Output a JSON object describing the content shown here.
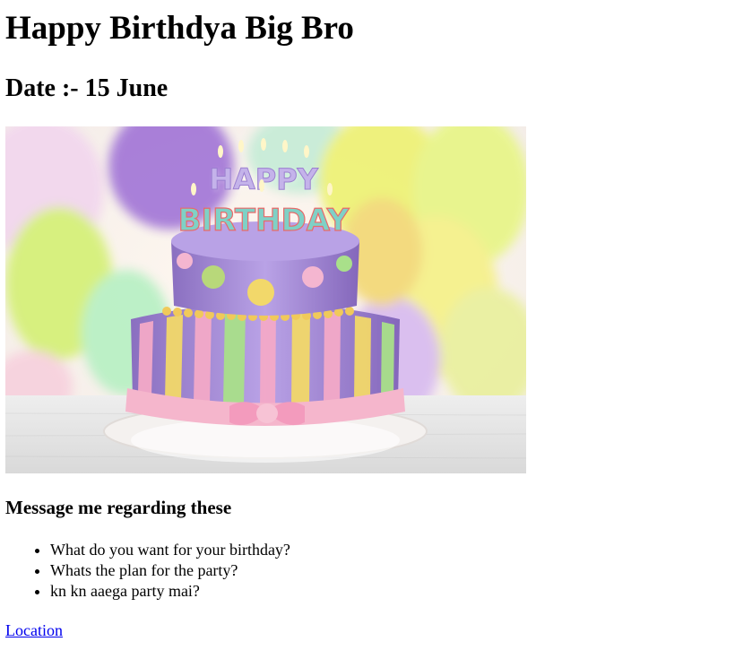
{
  "heading": "Happy Birthdya Big Bro",
  "date": "Date :- 15 June",
  "image": {
    "alt": "Birthday cake with HAPPY BIRTHDAY candles",
    "candle_text_top": "HAPPY",
    "candle_text_bottom": "BIRTHDAY"
  },
  "message_heading": "Message me regarding these",
  "items": [
    "What do you want for your birthday?",
    "Whats the plan for the party?",
    "kn kn aaega party mai?"
  ],
  "link": {
    "label": "Location",
    "href": "#"
  },
  "colors": {
    "link": "#0000ee",
    "cake_purple": "#a98fd6",
    "ribbon_pink": "#f5b6cc"
  }
}
